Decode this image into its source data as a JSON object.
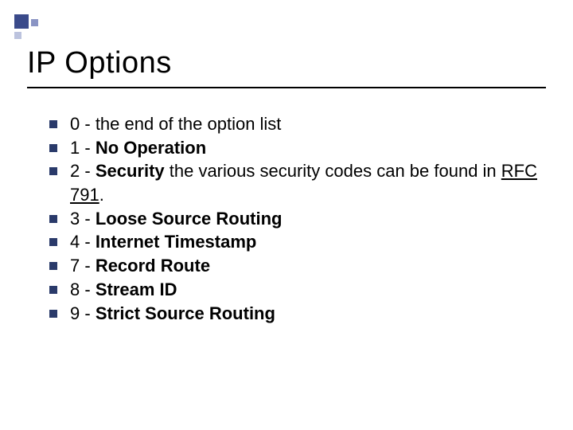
{
  "title": "IP Options",
  "items": [
    {
      "num": "0",
      "sep": " - ",
      "name": "",
      "rest": "the end of the option list"
    },
    {
      "num": "1",
      "sep": " - ",
      "name": "No Operation",
      "rest": ""
    },
    {
      "num": "2",
      "sep": " - ",
      "name": "Security",
      "rest": " the various security codes can be found in ",
      "link": "RFC 791",
      "after": "."
    },
    {
      "num": "3",
      "sep": " - ",
      "name": "Loose Source Routing",
      "rest": ""
    },
    {
      "num": "4",
      "sep": " - ",
      "name": "Internet Timestamp",
      "rest": ""
    },
    {
      "num": "7",
      "sep": " - ",
      "name": "Record Route",
      "rest": ""
    },
    {
      "num": "8",
      "sep": " - ",
      "name": "Stream ID",
      "rest": ""
    },
    {
      "num": "9",
      "sep": " - ",
      "name": "Strict Source Routing",
      "rest": ""
    }
  ]
}
